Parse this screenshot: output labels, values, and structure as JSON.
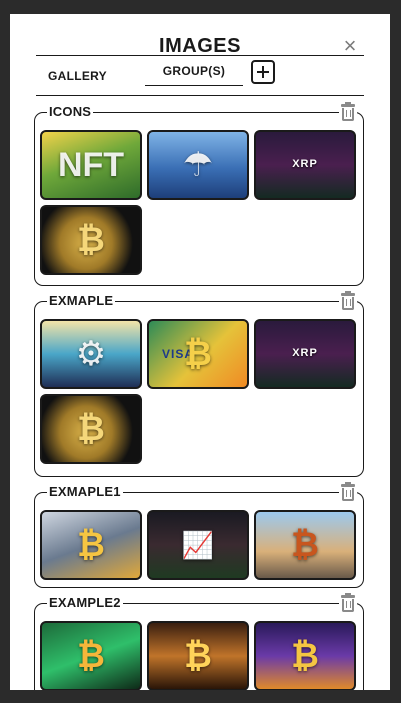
{
  "dialog": {
    "title": "IMAGES",
    "close_symbol": "×"
  },
  "tabs": [
    {
      "label": "GALLERY",
      "active": false
    },
    {
      "label": "GROUP(S)",
      "active": true
    }
  ],
  "add_button": {
    "icon": "plus-square-icon"
  },
  "groups": [
    {
      "name": "ICONS",
      "images": [
        {
          "icon": "nft-image",
          "caption": "NFT"
        },
        {
          "icon": "character-image",
          "caption": ""
        },
        {
          "icon": "crypto-tickers-image",
          "caption": "XRP"
        },
        {
          "icon": "bitcoin-coin-image",
          "caption": ""
        }
      ]
    },
    {
      "name": "EXMAPLE",
      "images": [
        {
          "icon": "robot-image",
          "caption": ""
        },
        {
          "icon": "visa-card-image",
          "caption": "VISA"
        },
        {
          "icon": "crypto-tickers-image",
          "caption": "XRP"
        },
        {
          "icon": "bitcoin-coin-image",
          "caption": ""
        }
      ]
    },
    {
      "name": "EXMAPLE1",
      "images": [
        {
          "icon": "bitcoin-robot-image",
          "caption": ""
        },
        {
          "icon": "trader-chart-image",
          "caption": ""
        },
        {
          "icon": "bitcoin-city-image",
          "caption": ""
        }
      ]
    },
    {
      "name": "EXAMPLE2",
      "images": [
        {
          "icon": "bitcoin-green-image",
          "caption": ""
        },
        {
          "icon": "bitcoin-crowd-image",
          "caption": ""
        },
        {
          "icon": "bitcoin-purple-image",
          "caption": ""
        }
      ]
    }
  ],
  "colors": {
    "backdrop": "#2b2b2b",
    "panel": "#ffffff",
    "text": "#1a1a1a",
    "icon_gray": "#8a8a8a"
  }
}
